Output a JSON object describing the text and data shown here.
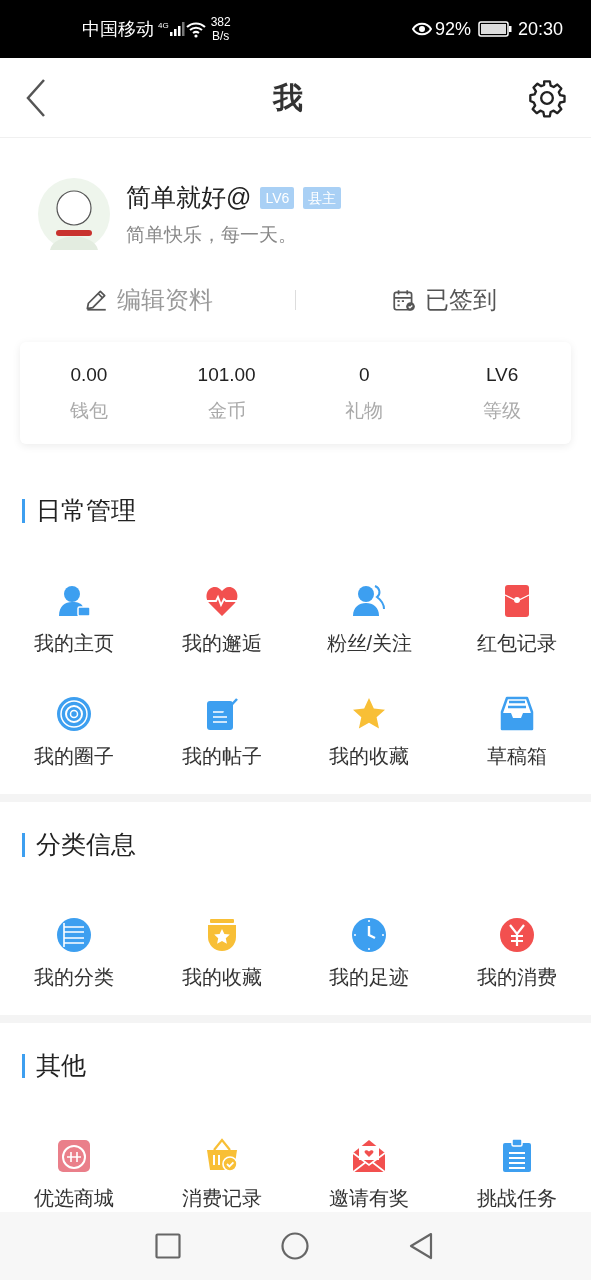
{
  "status_bar": {
    "carrier": "中国移动",
    "network": "4G",
    "speed": "382",
    "speed_unit": "B/s",
    "battery": "92%",
    "time": "20:30"
  },
  "header": {
    "title": "我"
  },
  "profile": {
    "name": "简单就好@",
    "badges": [
      "LV6",
      "县主"
    ],
    "motto": "简单快乐，每一天。"
  },
  "actions": [
    {
      "label": "编辑资料"
    },
    {
      "label": "已签到"
    }
  ],
  "stats": [
    {
      "value": "0.00",
      "label": "钱包"
    },
    {
      "value": "101.00",
      "label": "金币"
    },
    {
      "value": "0",
      "label": "礼物"
    },
    {
      "value": "LV6",
      "label": "等级"
    }
  ],
  "sections": [
    {
      "title": "日常管理",
      "items": [
        {
          "label": "我的主页",
          "color": "#3d9ff0"
        },
        {
          "label": "我的邂逅",
          "color": "#f2504f"
        },
        {
          "label": "粉丝/关注",
          "color": "#3d9ff0"
        },
        {
          "label": "红包记录",
          "color": "#f2504f"
        },
        {
          "label": "我的圈子",
          "color": "#3d9ff0"
        },
        {
          "label": "我的帖子",
          "color": "#3d9ff0"
        },
        {
          "label": "我的收藏",
          "color": "#f8bf36"
        },
        {
          "label": "草稿箱",
          "color": "#3d9ff0"
        }
      ]
    },
    {
      "title": "分类信息",
      "items": [
        {
          "label": "我的分类",
          "color": "#3d9ff0"
        },
        {
          "label": "我的收藏",
          "color": "#f8bf36"
        },
        {
          "label": "我的足迹",
          "color": "#3d9ff0"
        },
        {
          "label": "我的消费",
          "color": "#f2504f"
        }
      ]
    },
    {
      "title": "其他",
      "items": [
        {
          "label": "优选商城",
          "color": "#ea7f8a"
        },
        {
          "label": "消费记录",
          "color": "#f8bf36"
        },
        {
          "label": "邀请有奖",
          "color": "#f2504f"
        },
        {
          "label": "挑战任务",
          "color": "#3d9ff0"
        }
      ]
    }
  ]
}
